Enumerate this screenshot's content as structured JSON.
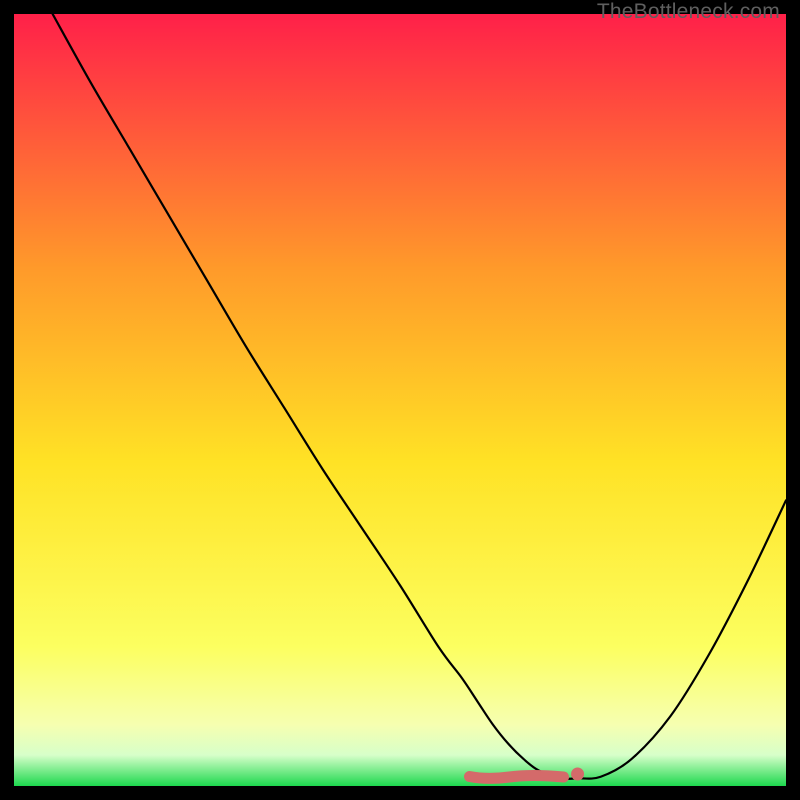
{
  "watermark": "TheBottleneck.com",
  "chart_data": {
    "type": "line",
    "title": "",
    "xlabel": "",
    "ylabel": "",
    "xlim": [
      0,
      100
    ],
    "ylim": [
      0,
      100
    ],
    "series": [
      {
        "name": "curve",
        "x": [
          5,
          10,
          15,
          20,
          25,
          30,
          35,
          40,
          45,
          50,
          55,
          58,
          60,
          62,
          64,
          66,
          68,
          71,
          73,
          76,
          80,
          85,
          90,
          95,
          100
        ],
        "values": [
          100,
          91,
          82.5,
          74,
          65.5,
          57,
          49,
          41,
          33.5,
          26,
          18,
          14,
          11,
          8,
          5.5,
          3.5,
          2,
          1,
          1,
          1.2,
          3.5,
          9,
          17,
          26.5,
          37
        ]
      }
    ],
    "flat_segment": {
      "x_start": 59,
      "x_end": 73,
      "marker_x": 73
    },
    "background_gradient": {
      "top": "#ff2049",
      "mid1": "#ff7a38",
      "mid2": "#ffd427",
      "mid3": "#fdfc4d",
      "bottom_yellow": "#fdfca0",
      "green": "#1dd84e"
    }
  }
}
